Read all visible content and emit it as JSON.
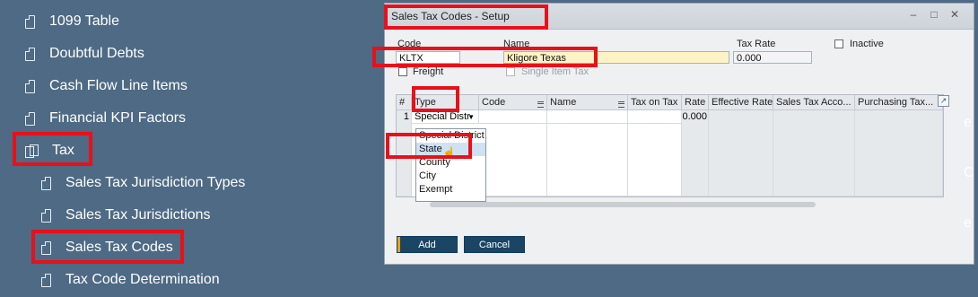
{
  "nav": {
    "items": [
      {
        "label": "1099 Table"
      },
      {
        "label": "Doubtful Debts"
      },
      {
        "label": "Cash Flow Line Items"
      },
      {
        "label": "Financial KPI Factors"
      },
      {
        "label": "Tax"
      },
      {
        "label": "Sales Tax Jurisdiction Types"
      },
      {
        "label": "Sales Tax Jurisdictions"
      },
      {
        "label": "Sales Tax Codes"
      },
      {
        "label": "Tax Code Determination"
      }
    ]
  },
  "dialog": {
    "title": "Sales Tax Codes - Setup",
    "code_label": "Code",
    "code_value": "KLTX",
    "name_label": "Name",
    "name_value": "Kligore Texas",
    "tax_rate_label": "Tax Rate",
    "tax_rate_value": "0.000",
    "inactive_label": "Inactive",
    "freight_label": "Freight",
    "single_item_tax_label": "Single Item Tax",
    "grid": {
      "columns": [
        "#",
        "Type",
        "Code",
        "Name",
        "Tax on Tax",
        "Rate",
        "Effective Rate",
        "Sales Tax Acco...",
        "Purchasing Tax..."
      ],
      "row1": {
        "num": "1",
        "type": "Special Distr",
        "rate": "0.000"
      }
    },
    "dropdown_options": [
      "Special District",
      "State",
      "County",
      "City",
      "Exempt"
    ],
    "selected_option": "State",
    "add_button": "Add",
    "cancel_button": "Cancel"
  },
  "colors": {
    "highlight": "#e8101a",
    "background": "#4e6a84",
    "button": "#1b4565"
  }
}
